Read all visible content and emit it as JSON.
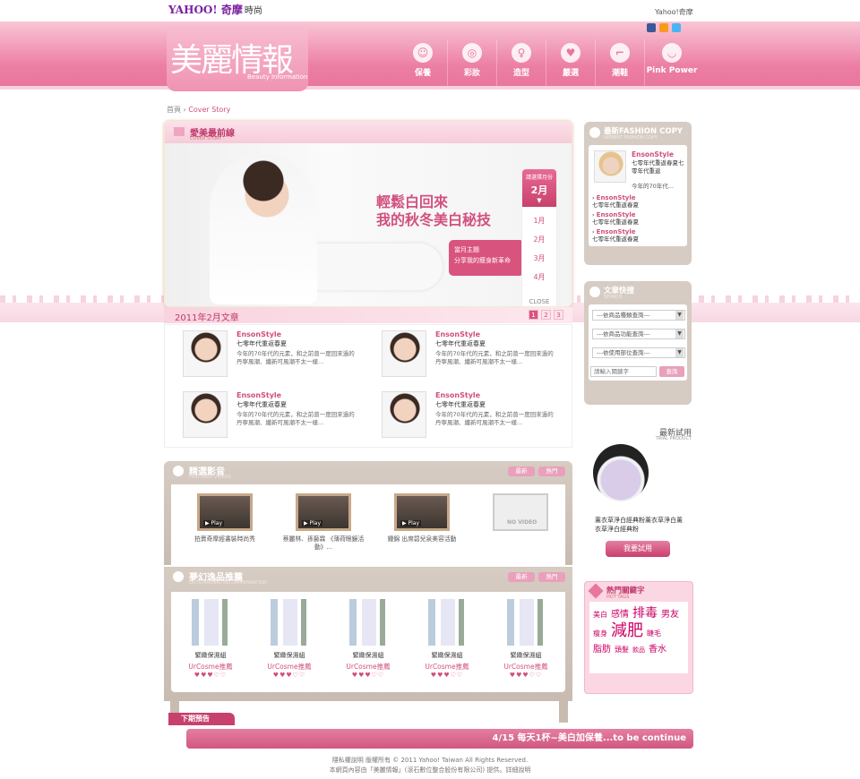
{
  "topbar": {
    "logo_main": "YAHOO!",
    "logo_sub": "奇摩",
    "logo_section": "時尚",
    "yahoo_link": "Yahoo!奇摩"
  },
  "brand": {
    "title": "美麗情報",
    "subtitle": "Beauty Information"
  },
  "nav": [
    {
      "label": "保養",
      "icon": "face-mask-icon"
    },
    {
      "label": "彩妝",
      "icon": "compact-mirror-icon"
    },
    {
      "label": "造型",
      "icon": "dress-icon"
    },
    {
      "label": "嚴選",
      "icon": "heart-icon"
    },
    {
      "label": "潮鞋",
      "icon": "high-heel-icon"
    },
    {
      "label": "Pink Power",
      "icon": "lips-icon"
    }
  ],
  "breadcrumb": {
    "home": "首頁",
    "sep": "›",
    "current": "Cover Story"
  },
  "feature": {
    "title": "愛美最前線",
    "subtitle": "COVER STORY",
    "headline_line1": "輕鬆白回來",
    "headline_line2": "我的秋冬美白秘技",
    "bubble_title": "當月主題",
    "bubble_text": "分享我的瘦身新革命",
    "month_picker": {
      "prompt": "請選擇月份",
      "current": "2月",
      "months": [
        "1月",
        "2月",
        "3月",
        "4月"
      ],
      "close": "CLOSE"
    },
    "list_title": "2011年2月文章",
    "pages": [
      "1",
      "2",
      "3"
    ]
  },
  "articles": [
    {
      "author": "EnsonStyle",
      "title": "七零年代重返春夏",
      "desc": "今年的70年代的元素，和之前曾一度回來過的丹寧風潮、纖新可風潮不太一樣..."
    },
    {
      "author": "EnsonStyle",
      "title": "七零年代重返春夏",
      "desc": "今年的70年代的元素，和之前曾一度回來過的丹寧風潮、纖新可風潮不太一樣..."
    },
    {
      "author": "EnsonStyle",
      "title": "七零年代重返春夏",
      "desc": "今年的70年代的元素，和之前曾一度回來過的丹寧風潮、纖新可風潮不太一樣..."
    },
    {
      "author": "EnsonStyle",
      "title": "七零年代重返春夏",
      "desc": "今年的70年代的元素，和之前曾一度回來過的丹寧風潮、纖新可風潮不太一樣..."
    }
  ],
  "videos": {
    "title": "精選影音",
    "subtitle": "FEATURED VIDEOS",
    "btn_latest": "最新",
    "btn_hot": "熱門",
    "items": [
      {
        "caption": "拍賣奇摩經書裝時尚秀"
      },
      {
        "caption": "蔡麗林、孫藝霖 《薄荷眼鏡活動》..."
      },
      {
        "caption": "鍾錦 出席碧兒泉美容活動"
      },
      {
        "caption": ""
      }
    ],
    "no_video": "NO VIDEO"
  },
  "products": {
    "title": "夢幻逸品推薦",
    "subtitle": "OUTSTANDING RECOMMENDATION",
    "btn_latest": "最新",
    "btn_hot": "熱門",
    "items": [
      {
        "name": "緊緻保濕組",
        "brand": "UrCosme推薦",
        "hearts": "♥♥♥♡♡"
      },
      {
        "name": "緊緻保濕組",
        "brand": "UrCosme推薦",
        "hearts": "♥♥♥♡♡"
      },
      {
        "name": "緊緻保濕組",
        "brand": "UrCosme推薦",
        "hearts": "♥♥♥♡♡"
      },
      {
        "name": "緊緻保濕組",
        "brand": "UrCosme推薦",
        "hearts": "♥♥♥♡♡"
      },
      {
        "name": "緊緻保濕組",
        "brand": "UrCosme推薦",
        "hearts": "♥♥♥♡♡"
      }
    ]
  },
  "fashion_copy": {
    "title": "最新FASHION COPY",
    "subtitle": "NEWEST FASHION COPY",
    "top": {
      "author": "EnsonStyle",
      "title": "七零年代重返春夏七零年代重返",
      "desc": "今年的70年代..."
    },
    "items": [
      {
        "author": "EnsonStyle",
        "title": "七零年代重返春夏"
      },
      {
        "author": "EnsonStyle",
        "title": "七零年代重返春夏"
      },
      {
        "author": "EnsonStyle",
        "title": "七零年代重返春夏"
      }
    ]
  },
  "search": {
    "title": "文章快搜",
    "subtitle": "SEARCH",
    "select1": "---依商品種類查詢---",
    "select2": "---依商品功能查詢---",
    "select3": "---依使用部位查詢---",
    "placeholder": "請輸入關鍵字",
    "button": "查詢"
  },
  "trial": {
    "title": "最新試用",
    "subtitle": "TRIAL PRODUCT",
    "desc": "薰衣草淨白經典粉薰衣草淨白薰衣草淨白經典粉",
    "button": "我要試用"
  },
  "tags": {
    "title": "熱門關鍵字",
    "subtitle": "HOT TAGS",
    "words": [
      {
        "text": "美白",
        "size": 8
      },
      {
        "text": "感情",
        "size": 10
      },
      {
        "text": "排毒",
        "size": 14
      },
      {
        "text": "男友",
        "size": 10
      },
      {
        "text": "瘦身",
        "size": 8
      },
      {
        "text": "減肥",
        "size": 18
      },
      {
        "text": "睫毛",
        "size": 8
      },
      {
        "text": "脂肪",
        "size": 10
      },
      {
        "text": "頭髮",
        "size": 8
      },
      {
        "text": "飲品",
        "size": 7
      },
      {
        "text": "香水",
        "size": 10
      }
    ]
  },
  "preview": {
    "tab": "下期預告",
    "text": "4/15 每天1杯~美白加保養...to be continue"
  },
  "footer": {
    "line1": "隱私權說明  版權所有 © 2011 Yahoo! Taiwan All Rights Reserved.",
    "line2": "本網頁內容由「美麗情報」(滾石數位整合股份有限公司) 提供。詳細說明"
  },
  "colors": {
    "brand_pink": "#e9769d",
    "accent": "#d04f7e",
    "taupe": "#c8bcb1"
  }
}
